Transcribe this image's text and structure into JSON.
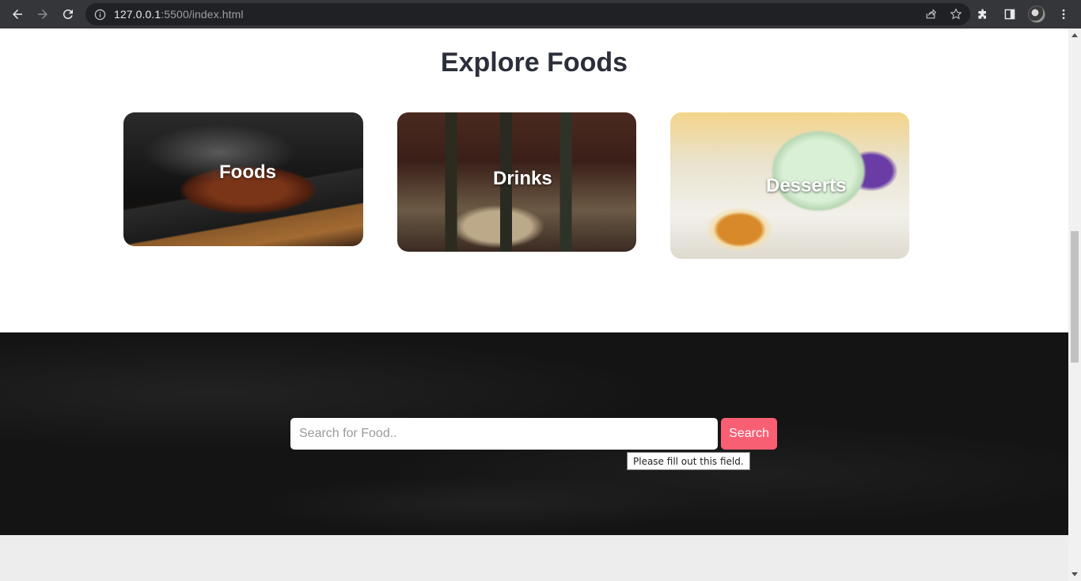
{
  "browser": {
    "url_host": "127.0.0.1",
    "url_rest": ":5500/index.html"
  },
  "section": {
    "title": "Explore Foods"
  },
  "cards": [
    {
      "label": "Foods"
    },
    {
      "label": "Drinks"
    },
    {
      "label": "Desserts"
    }
  ],
  "search": {
    "placeholder": "Search for Food..",
    "button_label": "Search",
    "validation_tooltip": "Please fill out this field."
  },
  "colors": {
    "accent": "#f95f73",
    "title": "#2c2f3b",
    "dark_band": "#141414"
  }
}
